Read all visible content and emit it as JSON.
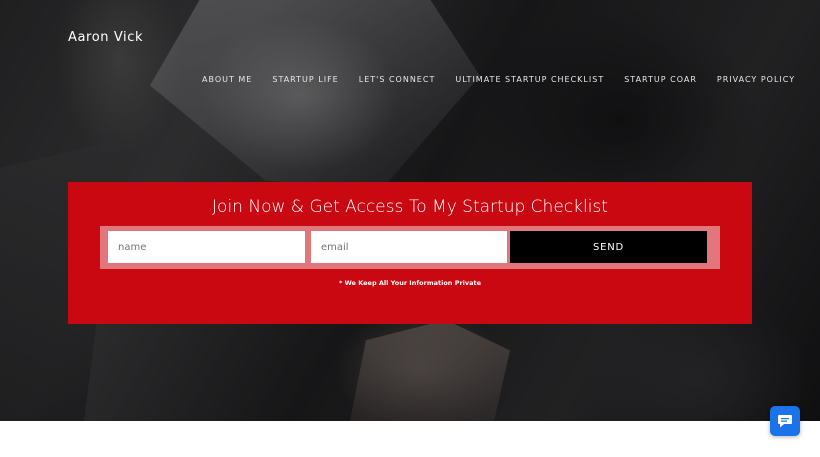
{
  "site": {
    "brand": "Aaron Vick"
  },
  "nav": {
    "items": [
      {
        "label": "ABOUT ME"
      },
      {
        "label": "STARTUP LIFE"
      },
      {
        "label": "LET'S CONNECT"
      },
      {
        "label": "ULTIMATE STARTUP CHECKLIST"
      },
      {
        "label": "STARTUP COAR"
      },
      {
        "label": "PRIVACY POLICY"
      }
    ]
  },
  "optin": {
    "title": "Join Now & Get Access To My Startup Checklist",
    "name_placeholder": "name",
    "email_placeholder": "email",
    "send_label": "SEND",
    "privacy_note": "* We Keep All Your Information Private"
  },
  "colors": {
    "accent_red": "#c90811",
    "send_black": "#000000",
    "chat_blue": "#1a73e8"
  },
  "icons": {
    "chat": "chat-bubble-icon"
  }
}
